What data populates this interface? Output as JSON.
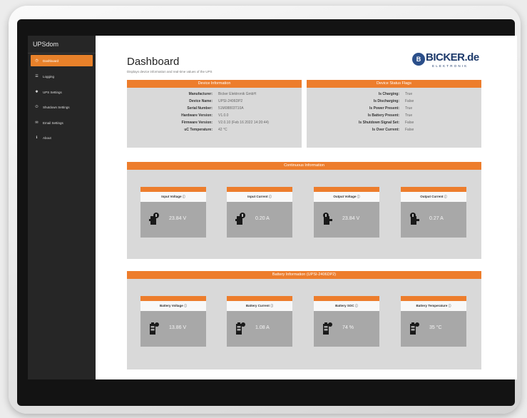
{
  "app": {
    "brand": "UPSdom",
    "brand_sub": ""
  },
  "sidebar": {
    "items": [
      {
        "label": "Dashboard",
        "icon": "dashboard-icon",
        "active": true
      },
      {
        "label": "Logging",
        "icon": "list-icon"
      },
      {
        "label": "UPS Settings",
        "icon": "gear-icon"
      },
      {
        "label": "Shutdown Settings",
        "icon": "power-icon"
      },
      {
        "label": "Email Settings",
        "icon": "envelope-icon"
      },
      {
        "label": "About",
        "icon": "info-icon"
      }
    ]
  },
  "page": {
    "title": "Dashboard",
    "subtitle": "Displays device information and real-time values of the UPS",
    "logo_text": "BICKER.de",
    "logo_sub": "ELEKTRONIK"
  },
  "device_info": {
    "title": "Device Information",
    "rows": [
      {
        "k": "Manufacturer:",
        "v": "Bicker Elektronik GmbH"
      },
      {
        "k": "Device Name:",
        "v": "UPSI-2406DP2"
      },
      {
        "k": "Serial Number:",
        "v": "51M08803T10A"
      },
      {
        "k": "Hardware Version:",
        "v": "V1.0.0"
      },
      {
        "k": "Firmware Version:",
        "v": "V2.0.10 (Feb 16 2022 14:20:44)"
      },
      {
        "k": "uC Temperature:",
        "v": "42 °C"
      }
    ]
  },
  "status_flags": {
    "title": "Device Status Flags",
    "rows": [
      {
        "k": "Is Charging:",
        "v": "True"
      },
      {
        "k": "Is Discharging:",
        "v": "False"
      },
      {
        "k": "Is Power Present:",
        "v": "True"
      },
      {
        "k": "Is Battery Present:",
        "v": "True"
      },
      {
        "k": "Is Shutdown Signal Set:",
        "v": "False"
      },
      {
        "k": "Is Over Current:",
        "v": "False"
      }
    ]
  },
  "continuous": {
    "title": "Continuous Information",
    "cards": [
      {
        "label": "Input Voltage",
        "value": "23.84 V",
        "icon": "plug-input-icon"
      },
      {
        "label": "Input Current",
        "value": "0.20 A",
        "icon": "plug-input-icon"
      },
      {
        "label": "Output Voltage",
        "value": "23.84 V",
        "icon": "plug-output-icon"
      },
      {
        "label": "Output Current",
        "value": "0.27 A",
        "icon": "plug-output-icon"
      }
    ]
  },
  "battery": {
    "title": "Battery Information (UPSI-2406DP2)",
    "cards": [
      {
        "label": "Battery Voltage",
        "value": "13.86 V",
        "icon": "battery-icon"
      },
      {
        "label": "Battery Current",
        "value": "1.08 A",
        "icon": "battery-icon"
      },
      {
        "label": "Battery SOC",
        "value": "74 %",
        "icon": "battery-icon"
      },
      {
        "label": "Battery Temperature",
        "value": "35 °C",
        "icon": "battery-icon"
      }
    ]
  },
  "colors": {
    "accent": "#ed7d2c",
    "sidebar": "#262626",
    "card_body": "#a8a8a8",
    "panel": "#d9d9d9"
  }
}
